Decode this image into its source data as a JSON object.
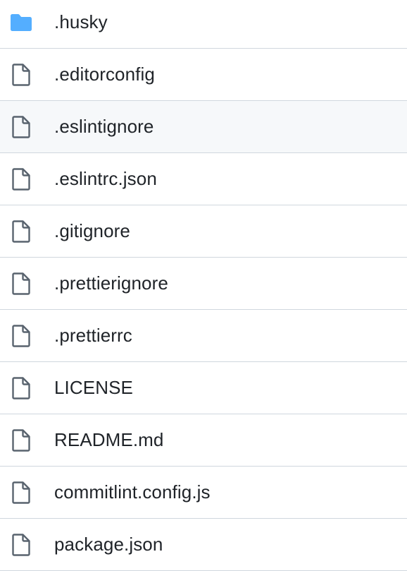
{
  "colors": {
    "folder": "#54aeff",
    "file_icon": "#59636e",
    "hover_row": "#f6f8fa",
    "divider": "#d0d7de",
    "text": "#1f2328"
  },
  "files": [
    {
      "name": ".husky",
      "icon": "folder-icon"
    },
    {
      "name": ".editorconfig",
      "icon": "file-icon"
    },
    {
      "name": ".eslintignore",
      "icon": "file-icon",
      "highlighted": true
    },
    {
      "name": ".eslintrc.json",
      "icon": "file-icon"
    },
    {
      "name": ".gitignore",
      "icon": "file-icon"
    },
    {
      "name": ".prettierignore",
      "icon": "file-icon"
    },
    {
      "name": ".prettierrc",
      "icon": "file-icon"
    },
    {
      "name": "LICENSE",
      "icon": "file-icon"
    },
    {
      "name": "README.md",
      "icon": "file-icon"
    },
    {
      "name": "commitlint.config.js",
      "icon": "file-icon"
    },
    {
      "name": "package.json",
      "icon": "file-icon"
    }
  ]
}
